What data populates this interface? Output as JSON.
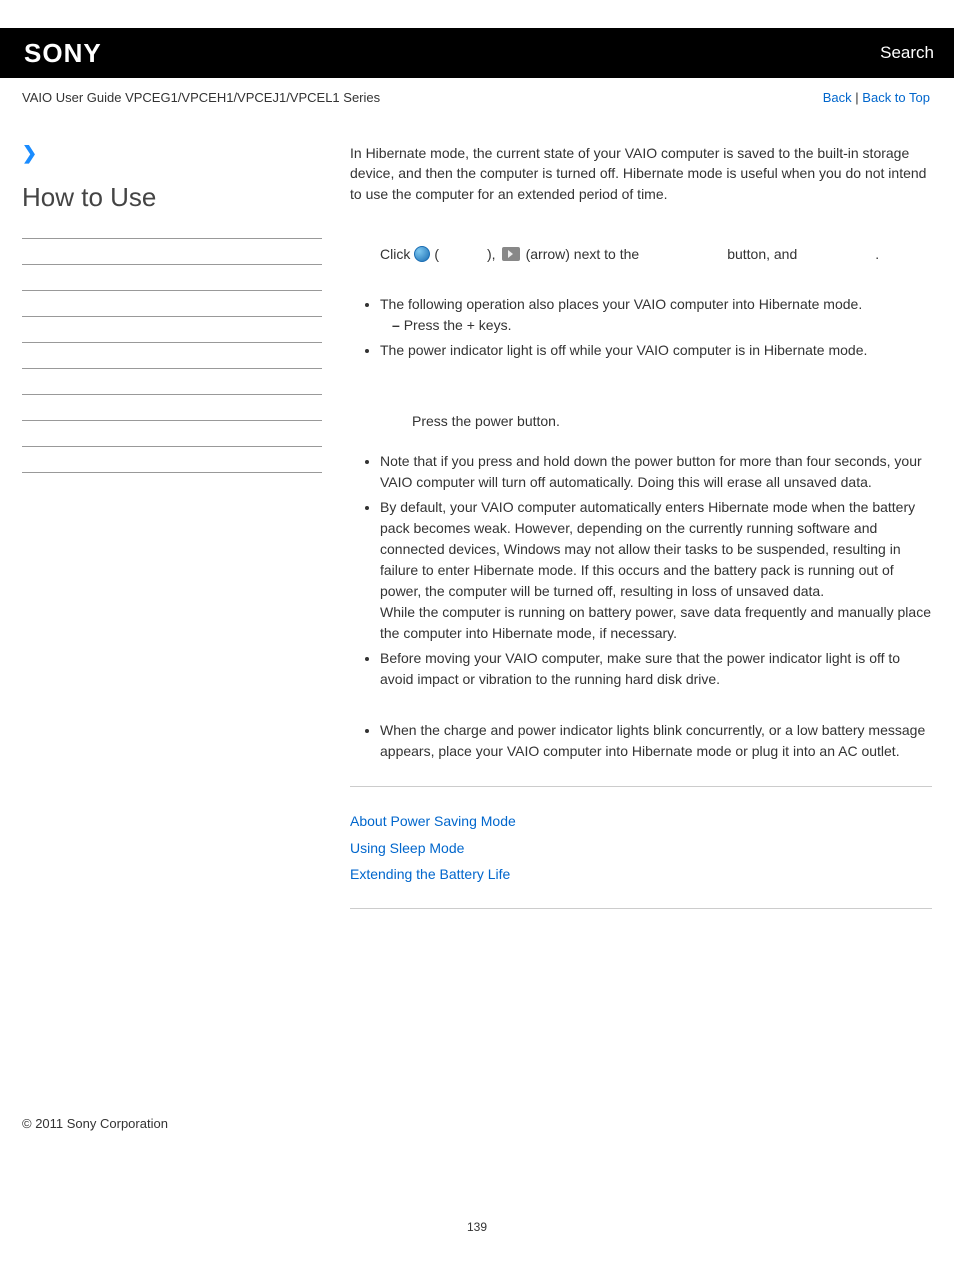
{
  "header": {
    "logo": "SONY",
    "search": "Search"
  },
  "subbar": {
    "title": "VAIO User Guide VPCEG1/VPCEH1/VPCEJ1/VPCEL1 Series",
    "back": "Back",
    "back_to_top": "Back to Top"
  },
  "sidebar": {
    "arrow": "❯",
    "heading": "How to Use"
  },
  "main": {
    "intro": "In Hibernate mode, the current state of your VAIO computer is saved to the built-in storage device, and then the computer is turned off. Hibernate mode is useful when you do not intend to use the computer for an extended period of time.",
    "step1": {
      "click": "Click",
      "open_paren": " (",
      "close_paren": "), ",
      "arrow_next": " (arrow) next to the ",
      "button_and": " button, and ",
      "period": "."
    },
    "bullets1": {
      "b1": "The following operation also places your VAIO computer into Hibernate mode.",
      "b1sub": "Press the      +        keys.",
      "b2": "The power indicator light is off while your VAIO computer is in Hibernate mode."
    },
    "return_step": "Press the power button.",
    "bullets2": {
      "b1": "Note that if you press and hold down the power button for more than four seconds, your VAIO computer will turn off automatically. Doing this will erase all unsaved data.",
      "b2a": "By default, your VAIO computer automatically enters Hibernate mode when the battery pack becomes weak. However, depending on the currently running software and connected devices, Windows may not allow their tasks to be suspended, resulting in failure to enter Hibernate mode. If this occurs and the battery pack is running out of power, the computer will be turned off, resulting in loss of unsaved data.",
      "b2b": "While the computer is running on battery power, save data frequently and manually place the computer into Hibernate mode, if necessary.",
      "b3": "Before moving your VAIO computer, make sure that the power indicator light is off to avoid impact or vibration to the running hard disk drive."
    },
    "bullets3": {
      "b1": "When the charge and power indicator lights blink concurrently, or a low battery message appears, place your VAIO computer into Hibernate mode or plug it into an AC outlet."
    },
    "related": {
      "r1": "About Power Saving Mode",
      "r2": "Using Sleep Mode",
      "r3": "Extending the Battery Life"
    }
  },
  "footer": {
    "copyright": "© 2011 Sony Corporation",
    "page_num": "139"
  }
}
